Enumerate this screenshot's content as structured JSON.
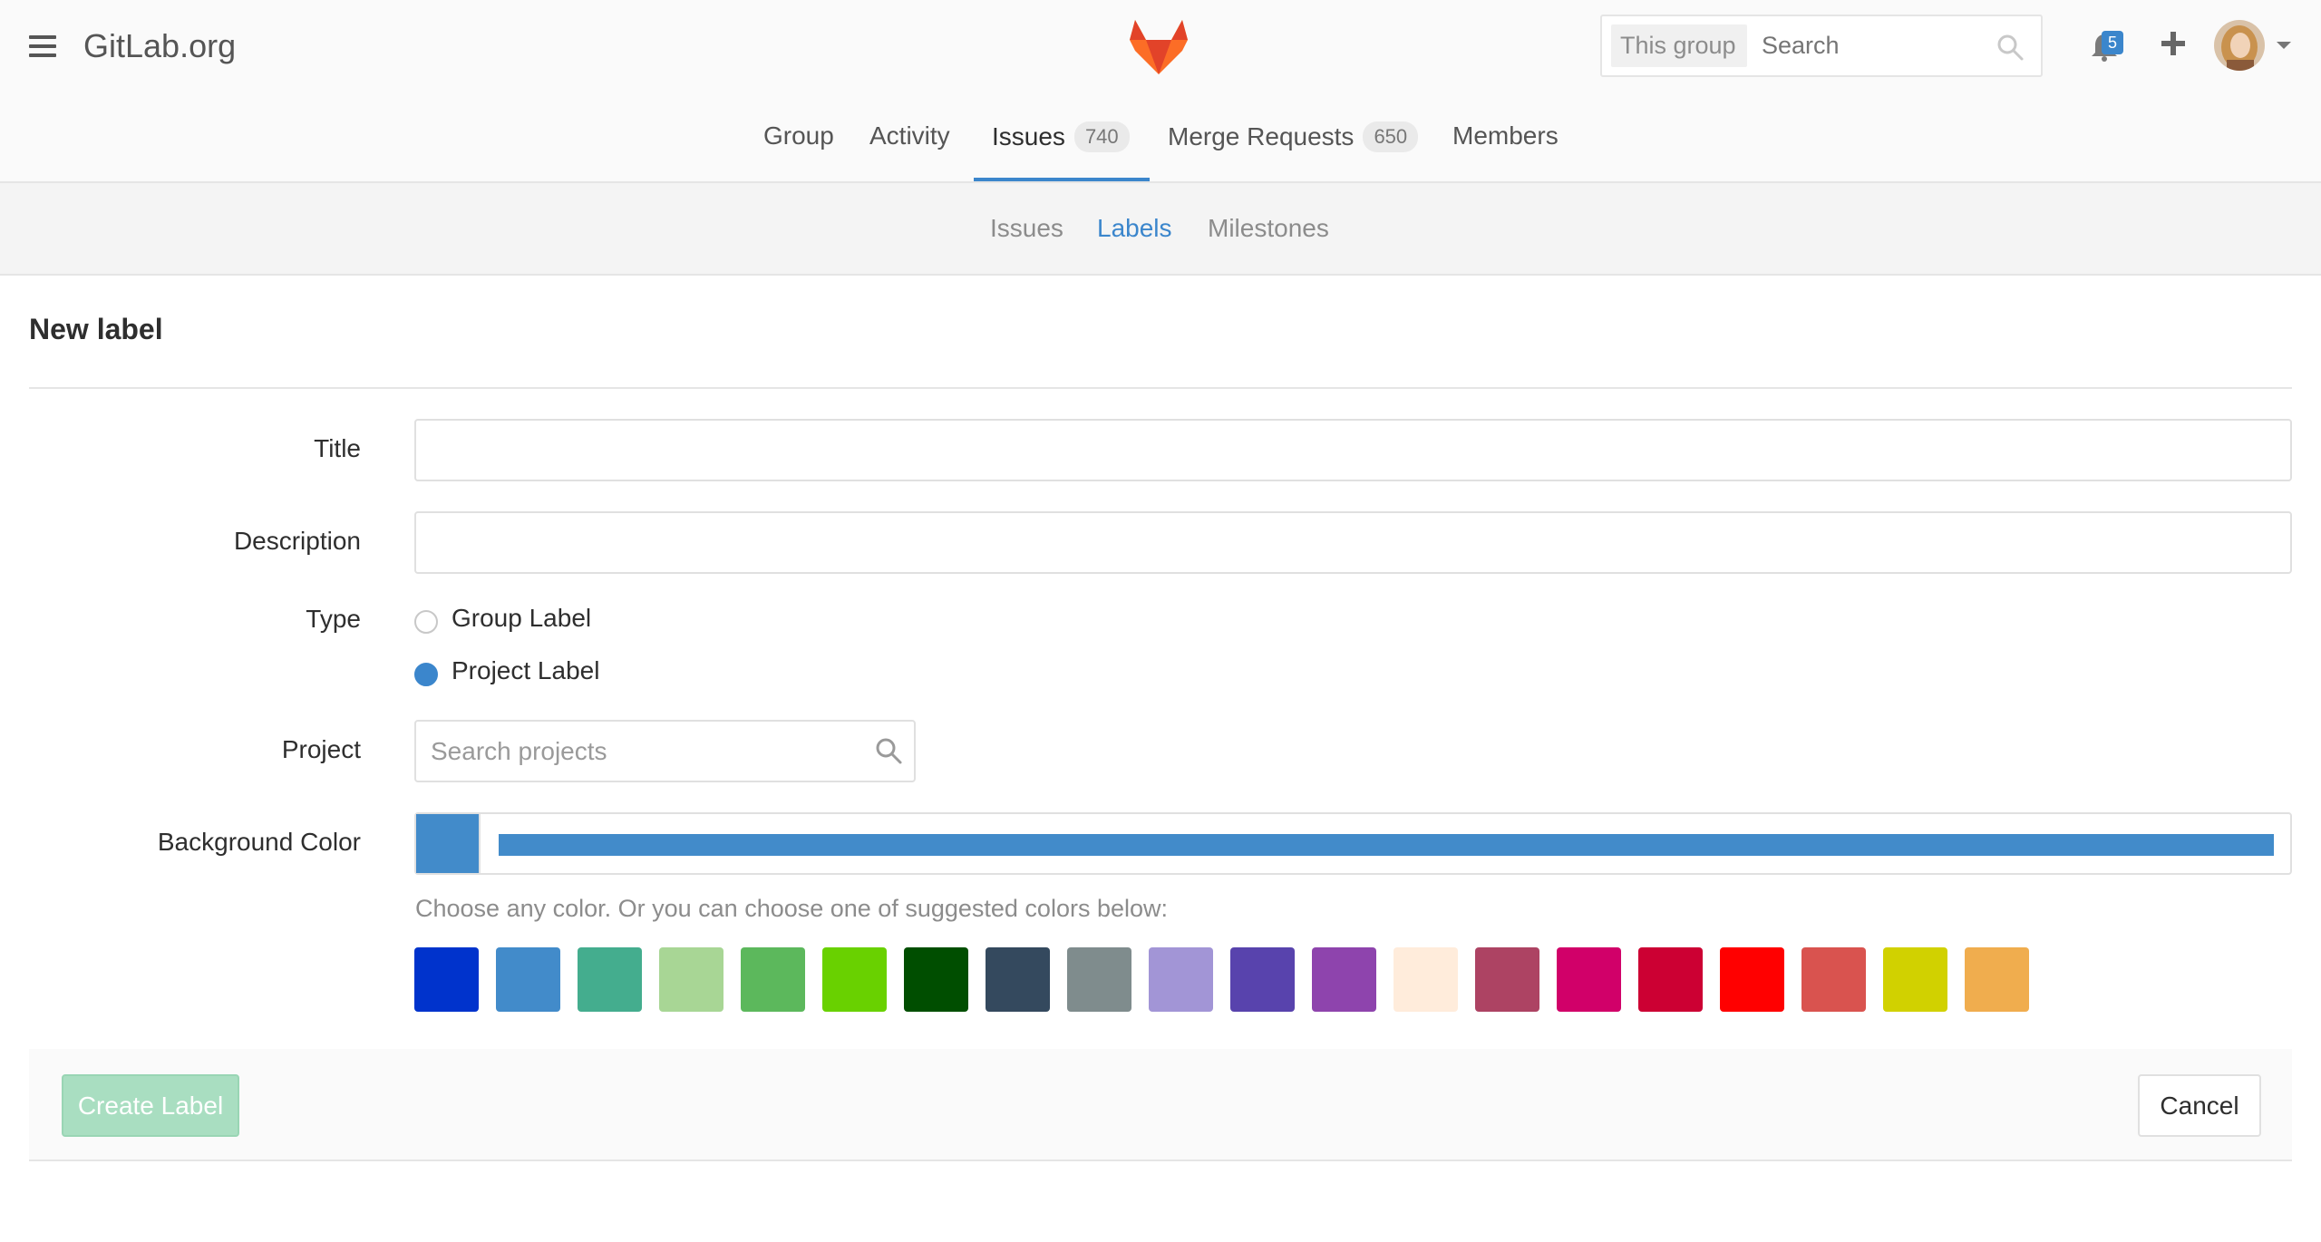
{
  "header": {
    "brand": "GitLab.org",
    "search": {
      "scope": "This group",
      "placeholder": "Search"
    },
    "notifications_count": "5"
  },
  "nav": {
    "items": [
      {
        "label": "Group"
      },
      {
        "label": "Activity"
      },
      {
        "label": "Issues",
        "count": "740",
        "active": true
      },
      {
        "label": "Merge Requests",
        "count": "650"
      },
      {
        "label": "Members"
      }
    ]
  },
  "subnav": {
    "items": [
      {
        "label": "Issues"
      },
      {
        "label": "Labels",
        "active": true
      },
      {
        "label": "Milestones"
      }
    ]
  },
  "page": {
    "title": "New label"
  },
  "form": {
    "title_label": "Title",
    "title_value": "",
    "description_label": "Description",
    "description_value": "",
    "type_label": "Type",
    "type_options": [
      {
        "label": "Group Label",
        "checked": false
      },
      {
        "label": "Project Label",
        "checked": true
      }
    ],
    "project_label": "Project",
    "project_placeholder": "Search projects",
    "bg_color_label": "Background Color",
    "bg_color_value": "#428bca",
    "hint": "Choose any color. Or you can choose one of suggested colors below:",
    "suggested_colors": [
      "#0033cc",
      "#428bca",
      "#44ad8e",
      "#a8d695",
      "#5cb85c",
      "#69d100",
      "#004e00",
      "#34495e",
      "#7f8c8d",
      "#a295d6",
      "#5843ad",
      "#8e44ad",
      "#ffecdb",
      "#ad4363",
      "#d10069",
      "#cc0033",
      "#ff0000",
      "#d9534f",
      "#d1d100",
      "#f0ad4e"
    ],
    "create_button": "Create Label",
    "cancel_button": "Cancel"
  },
  "colors": {
    "accent": "#3b86cc",
    "create_button_bg": "#a9dec1"
  }
}
